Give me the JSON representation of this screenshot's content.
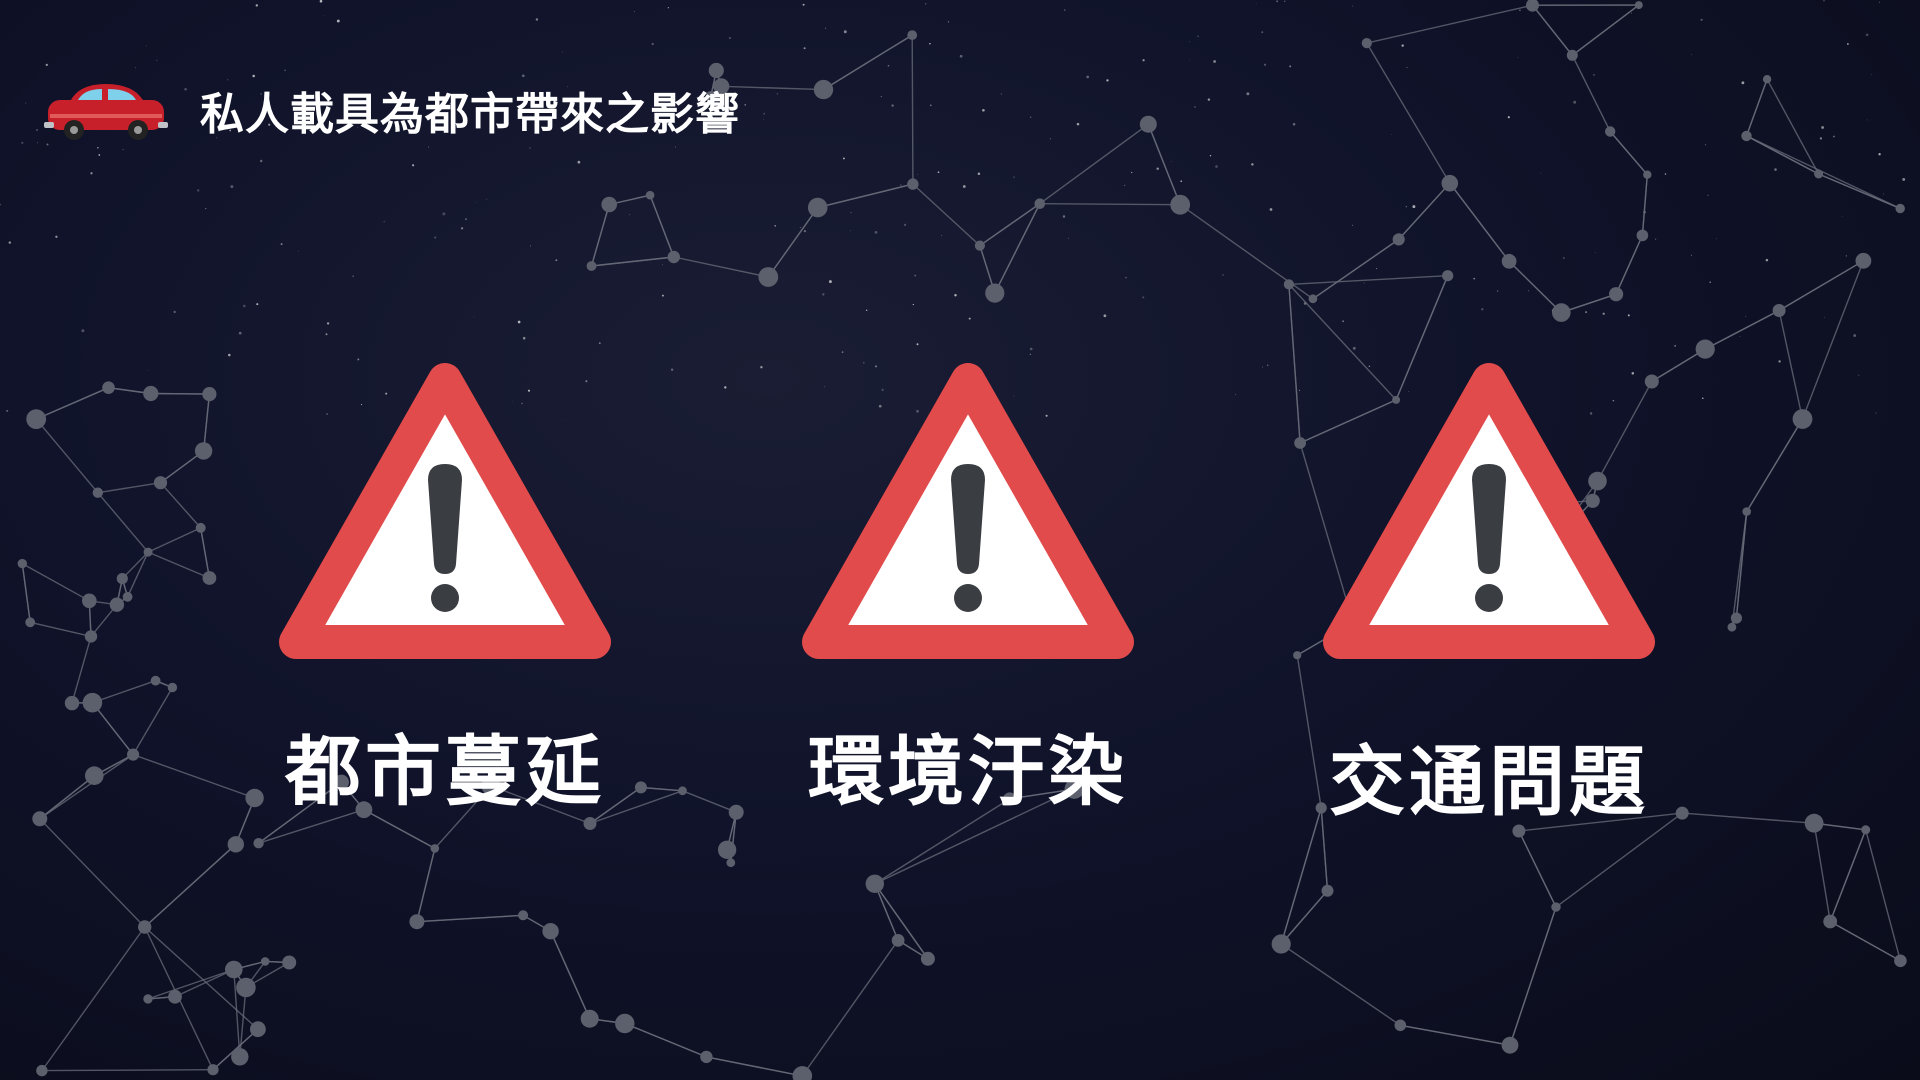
{
  "slide": {
    "title": "私人載具為都市帶來之影響",
    "title_icon": "car-icon"
  },
  "warnings": [
    {
      "label": "都市蔓延",
      "icon": "warning-triangle-icon"
    },
    {
      "label": "環境汙染",
      "icon": "warning-triangle-icon"
    },
    {
      "label": "交通問題",
      "icon": "warning-triangle-icon"
    }
  ],
  "colors": {
    "background": "#0c0f1e",
    "warning_red": "#e24b4b",
    "warning_fill": "#ffffff",
    "exclamation": "#3a3d42",
    "text": "#ffffff",
    "car_body": "#c8202a",
    "car_window": "#7fd0ea",
    "network_lines": "#6a6d7a"
  }
}
